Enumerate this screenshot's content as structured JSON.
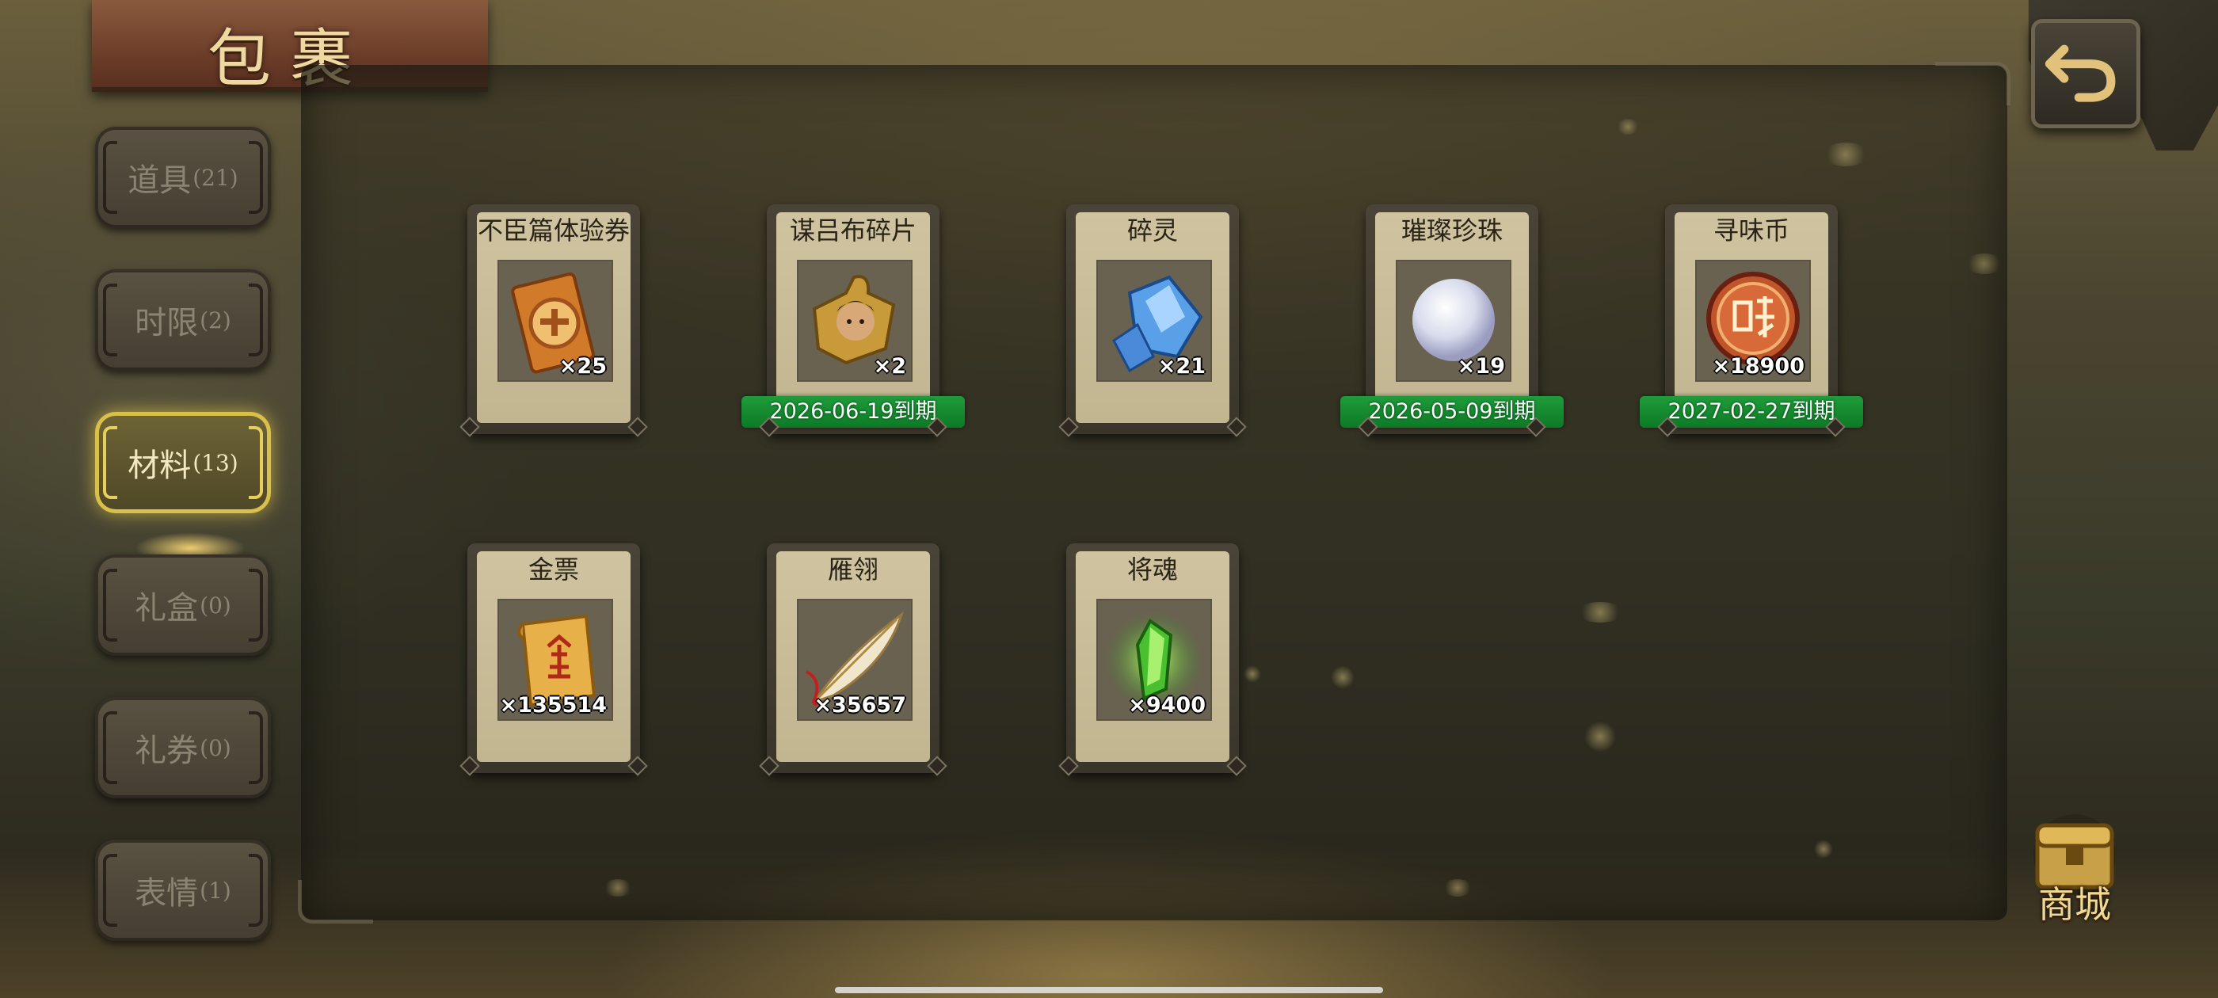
{
  "title": "包裹",
  "tabs": [
    {
      "label": "道具",
      "count": "(21)",
      "active": false
    },
    {
      "label": "时限",
      "count": "(2)",
      "active": false
    },
    {
      "label": "材料",
      "count": "(13)",
      "active": true
    },
    {
      "label": "礼盒",
      "count": "(0)",
      "active": false
    },
    {
      "label": "礼券",
      "count": "(0)",
      "active": false
    },
    {
      "label": "表情",
      "count": "(1)",
      "active": false
    }
  ],
  "items": [
    {
      "name": "不臣篇体验券",
      "qty": "×25",
      "expiry": "",
      "icon": "ticket-icon"
    },
    {
      "name": "谋吕布碎片",
      "qty": "×2",
      "expiry": "2026-06-19到期",
      "icon": "puzzle-piece-icon"
    },
    {
      "name": "碎灵",
      "qty": "×21",
      "expiry": "",
      "icon": "crystal-icon"
    },
    {
      "name": "璀璨珍珠",
      "qty": "×19",
      "expiry": "2026-05-09到期",
      "icon": "pearl-icon"
    },
    {
      "name": "寻味币",
      "qty": "×18900",
      "expiry": "2027-02-27到期",
      "icon": "coin-icon"
    },
    {
      "name": "金票",
      "qty": "×135514",
      "expiry": "",
      "icon": "gold-scroll-icon"
    },
    {
      "name": "雁翎",
      "qty": "×35657",
      "expiry": "",
      "icon": "feather-icon"
    },
    {
      "name": "将魂",
      "qty": "×9400",
      "expiry": "",
      "icon": "green-soul-crystal-icon"
    }
  ],
  "shop": {
    "label": "商城",
    "icon": "shop-chest-icon"
  },
  "back": {
    "icon": "back-arrow-icon"
  },
  "colors": {
    "expiry_green": "#1f9c3a",
    "active_tab_border": "#d9c04a",
    "title_plaque": "#6e3f2a"
  }
}
